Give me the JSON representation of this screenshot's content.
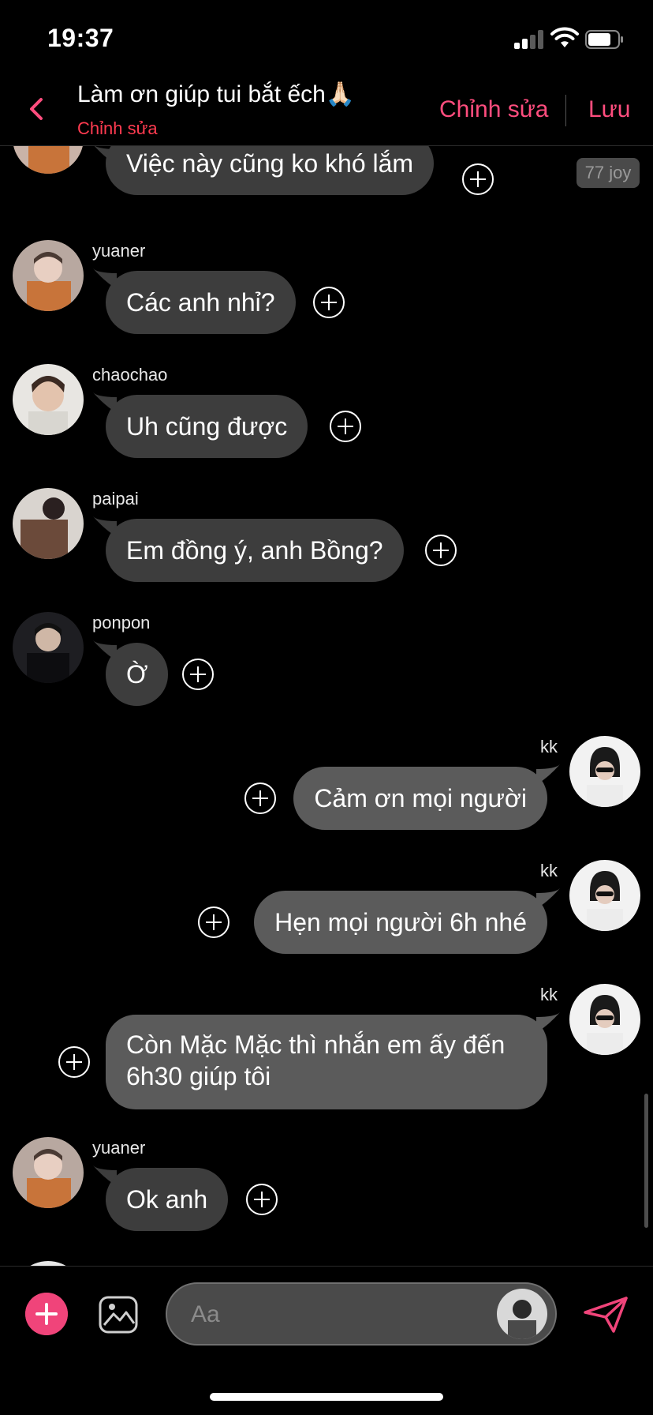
{
  "status_bar": {
    "time": "19:37"
  },
  "header": {
    "title": "Làm ơn giúp tui bắt ếch🙏🏻",
    "subtitle": "Chỉnh sửa",
    "edit_label": "Chỉnh sửa",
    "save_label": "Lưu"
  },
  "messages": [
    {
      "sender": "",
      "text": "Việc này cũng ko khó lắm",
      "badge": "77 joy"
    },
    {
      "sender": "yuaner",
      "text": "Các anh nhỉ?"
    },
    {
      "sender": "chaochao",
      "text": "Uh cũng được"
    },
    {
      "sender": "paipai",
      "text": "Em đồng ý, anh Bồng?"
    },
    {
      "sender": "ponpon",
      "text": "Ờ"
    },
    {
      "sender": "kk",
      "text": "Cảm ơn mọi người"
    },
    {
      "sender": "kk",
      "text": "Hẹn mọi người 6h nhé"
    },
    {
      "sender": "kk",
      "text": "Còn Mặc Mặc thì nhắn em ấy đến 6h30 giúp tôi"
    },
    {
      "sender": "yuaner",
      "text": "Ok anh"
    }
  ],
  "composer": {
    "placeholder": "Aa"
  },
  "colors": {
    "accent": "#f0447a",
    "header_action": "#ff4d7e",
    "subtitle": "#ff3b50",
    "bubble_other": "#3d3d3d",
    "bubble_self": "#5b5b5b",
    "background": "#000000"
  },
  "icons": {
    "back": "chevron-left-icon",
    "react": "plus-circle-icon",
    "add": "plus-icon",
    "image": "image-icon",
    "send": "send-icon"
  }
}
